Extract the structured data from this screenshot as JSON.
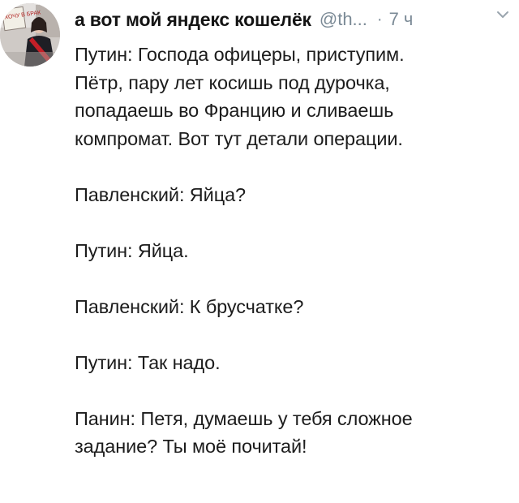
{
  "tweet": {
    "display_name": "а вот мой яндекс кошелёк",
    "handle": "@th...",
    "separator": "·",
    "time": "7 ч",
    "avatar": {
      "sign_text": "ХОЧУ В БРАК"
    },
    "paragraphs": [
      {
        "lines": [
          "Путин: Господа офицеры, приступим.",
          "Пётр, пару лет косишь под дурочка,",
          "попадаешь во Францию и сливаешь",
          "компромат. Вот тут детали операции."
        ]
      },
      {
        "lines": [
          "Павленский: Яйца?"
        ]
      },
      {
        "lines": [
          "Путин: Яйца."
        ]
      },
      {
        "lines": [
          "Павленский: К брусчатке?"
        ]
      },
      {
        "lines": [
          "Путин: Так надо."
        ]
      },
      {
        "lines": [
          "Панин: Петя, думаешь у тебя сложное",
          "задание? Ты моё почитай!"
        ]
      }
    ]
  },
  "colors": {
    "name": "#141414",
    "meta": "#7b8a96",
    "text": "#1c1c1c",
    "background": "#ffffff"
  },
  "icons": {
    "menu": "chevron-down-icon"
  }
}
